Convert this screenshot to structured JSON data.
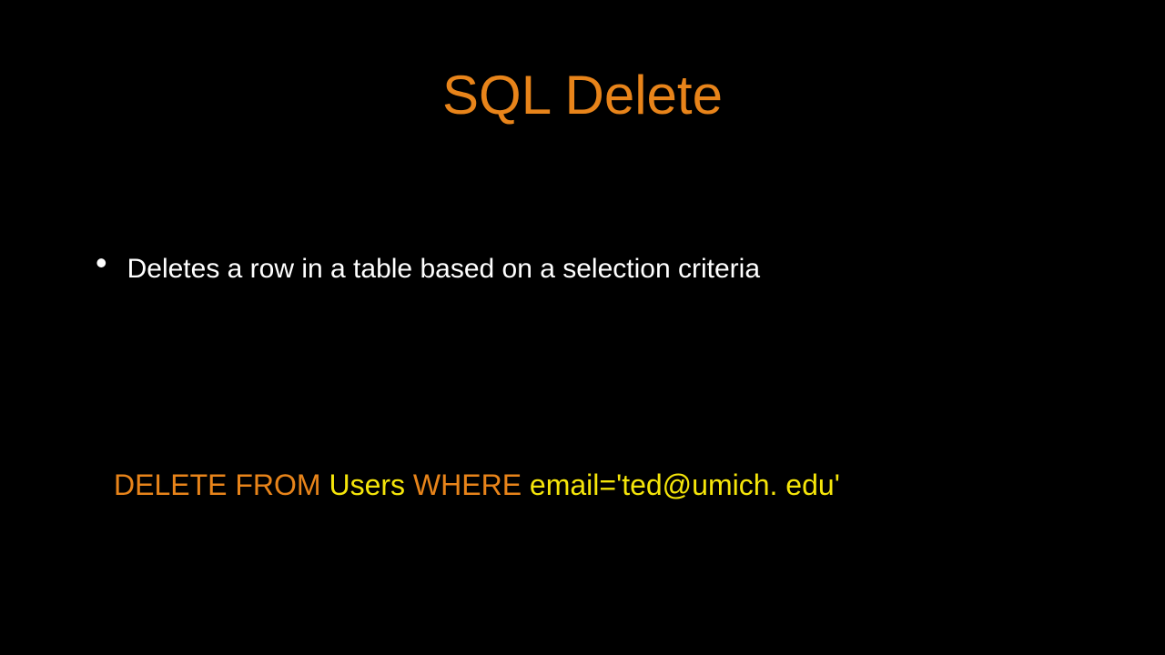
{
  "slide": {
    "title": "SQL Delete",
    "bullets": [
      "Deletes a row in a table based on a selection criteria"
    ],
    "code": {
      "kw1": "DELETE FROM ",
      "id1": "Users ",
      "kw2": "WHERE ",
      "id2": "email='ted@umich. edu'"
    }
  }
}
